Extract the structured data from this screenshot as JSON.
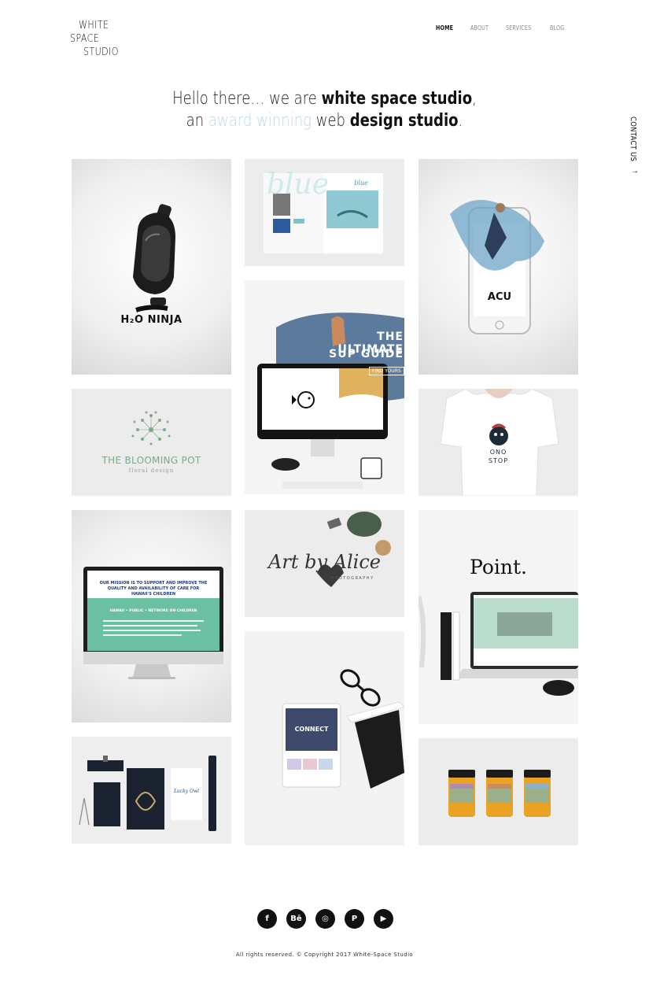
{
  "logo": {
    "line1": "WHITE",
    "line2": "SPACE",
    "line3": "STUDIO"
  },
  "nav": {
    "items": [
      {
        "label": "HOME",
        "active": true
      },
      {
        "label": "ABOUT",
        "active": false
      },
      {
        "label": "SERVICES",
        "active": false
      },
      {
        "label": "BLOG",
        "active": false
      }
    ]
  },
  "contact": {
    "label": "CONTACT US",
    "arrow": "→"
  },
  "headline": {
    "line1_a": "Hello there… we are ",
    "line1_b": "white space studio",
    "line1_c": ",",
    "line2_a": "an ",
    "line2_b": "award winning",
    "line2_c": " web ",
    "line2_d": "design studio",
    "line2_e": "."
  },
  "tiles": {
    "h2o": {
      "caption": "H₂O NINJA"
    },
    "blue_magazine": {
      "caption": "blue"
    },
    "sup": {
      "title1": "THE ULTIMATE",
      "title2": "SUP GUIDE",
      "button": "FIND YOURS"
    },
    "acu": {
      "caption": "ACU"
    },
    "blooming": {
      "title": "THE BLOOMING POT",
      "subtitle": "floral design"
    },
    "ono": {
      "line1": "ONO",
      "line2": "STOP"
    },
    "mission": {
      "text": "OUR MISSION IS TO SUPPORT AND IMPROVE THE QUALITY AND AVAILABILITY OF CARE FOR HAWAII'S CHILDREN",
      "band": "HAWAII • PUBLIC • NETWORK ON CHILDREN"
    },
    "artbyalice": {
      "title": "Art by Alice",
      "subtitle": "PHOTOGRAPHY"
    },
    "point": {
      "title": "Point."
    },
    "connect": {
      "caption": "CONNECT"
    },
    "lucky_owl": {
      "caption": "Lucky Owl"
    }
  },
  "social": {
    "items": [
      {
        "icon": "facebook-icon",
        "glyph": "f"
      },
      {
        "icon": "behance-icon",
        "glyph": "Bē"
      },
      {
        "icon": "instagram-icon",
        "glyph": "◎"
      },
      {
        "icon": "pinterest-icon",
        "glyph": "P"
      },
      {
        "icon": "youtube-icon",
        "glyph": "▶"
      }
    ]
  },
  "footer": {
    "text": "All rights reserved. © Copyright 2017 White-Space Studio"
  }
}
